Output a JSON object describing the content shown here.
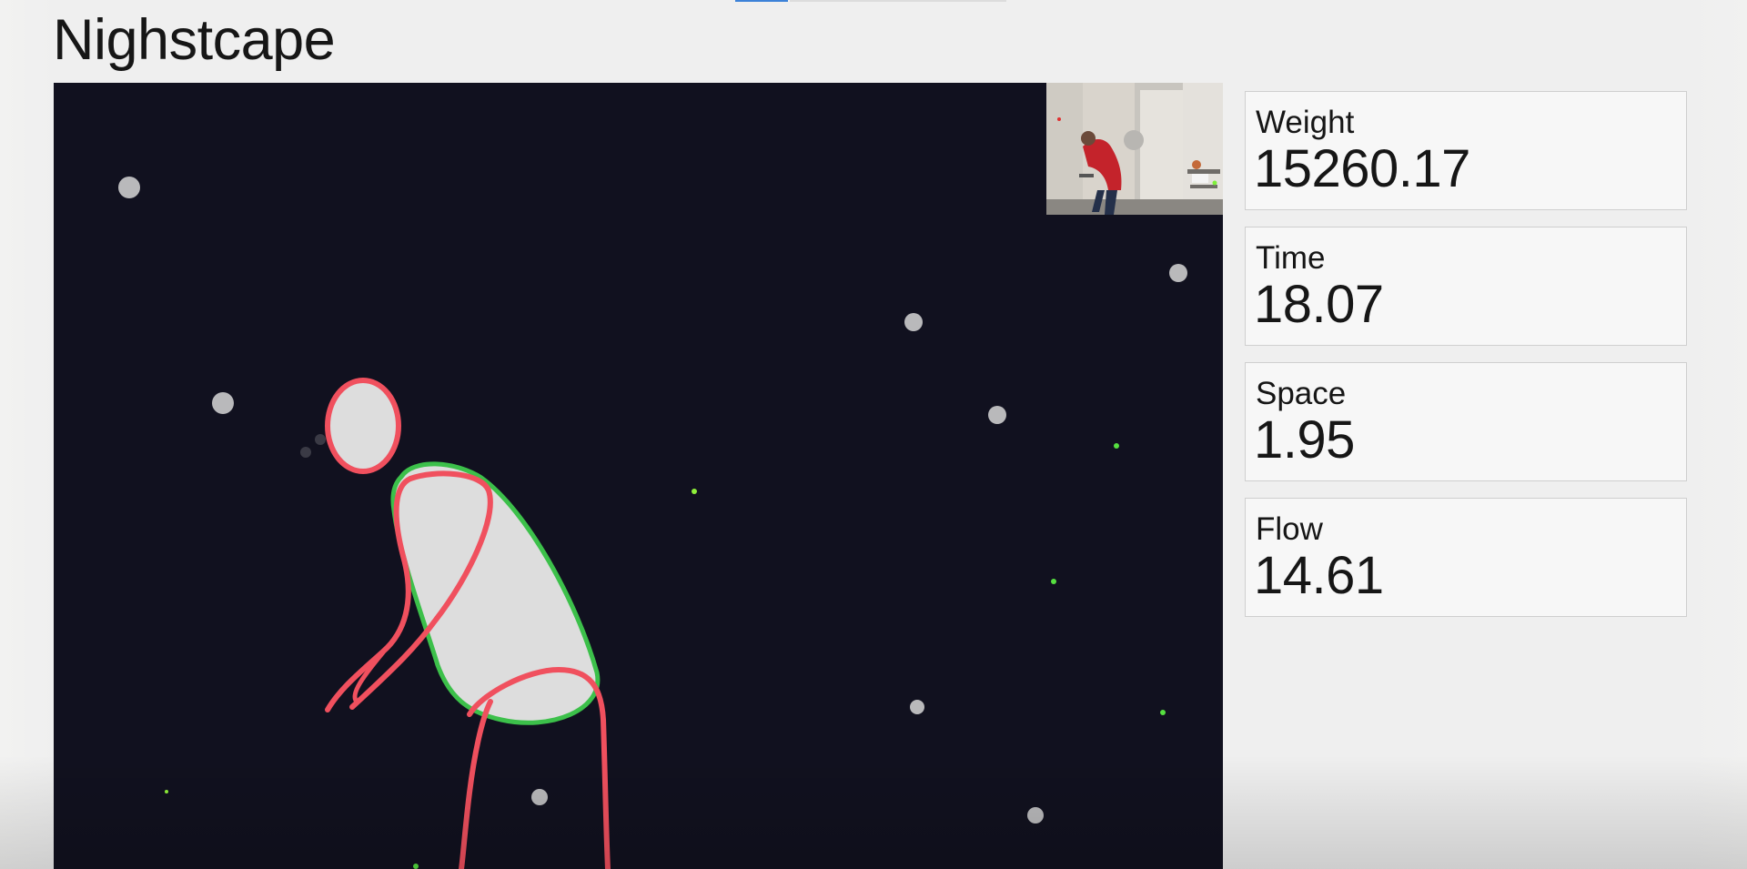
{
  "app": {
    "title": "Nighstcape"
  },
  "visualizer": {
    "background_color": "#11111f",
    "figure_fill": "#dddddd",
    "outline_red": "#f0505e",
    "outline_green": "#3cc04a",
    "particle_gray": "#bdbdbd",
    "particle_green": "#7ff03a",
    "camera_preview": "webcam-preview-image"
  },
  "metrics": [
    {
      "label": "Weight",
      "value": "15260.17"
    },
    {
      "label": "Time",
      "value": "18.07"
    },
    {
      "label": "Space",
      "value": "1.95"
    },
    {
      "label": "Flow",
      "value": "14.61"
    }
  ]
}
